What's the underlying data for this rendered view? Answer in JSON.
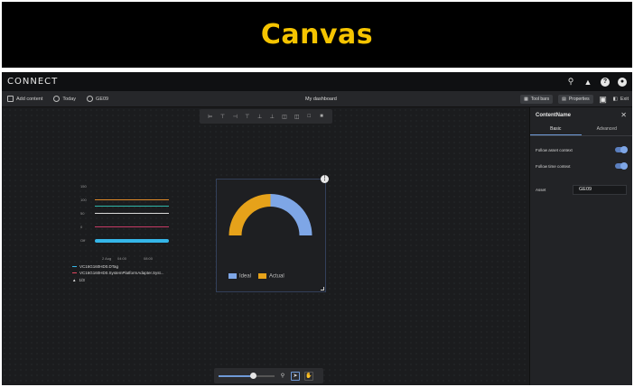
{
  "banner": {
    "title": "Canvas"
  },
  "app": {
    "logo": "CONNECT",
    "toolbar": {
      "add_content": "Add content",
      "today": "Today",
      "asset": "GE09",
      "title": "My dashboard",
      "tool_bars": "Tool bars",
      "properties": "Properties",
      "exit": "Exit"
    }
  },
  "line_widget": {
    "y_ticks": [
      "150",
      "100",
      "50",
      "0",
      "Off"
    ],
    "x_ticks": [
      "2 Aug",
      "04:00",
      "08:00"
    ],
    "legend": [
      {
        "name": "VC16G160HD0.DTag",
        "color": "#35b6e8"
      },
      {
        "name": "VC16G160HD0.SystemPlatformAdapter.Syst...",
        "color": "#e0455e"
      }
    ],
    "pager": "1/3",
    "lines": [
      {
        "color": "#e08a28"
      },
      {
        "color": "#2fb6a8"
      },
      {
        "color": "#d9d9d9"
      },
      {
        "color": "#c73b66"
      },
      {
        "color": "#35b6e8"
      }
    ]
  },
  "gauge_widget": {
    "chart_data": {
      "type": "pie",
      "series": [
        {
          "name": "Ideal",
          "color": "#7ea6e6",
          "value": 0.5
        },
        {
          "name": "Actual",
          "color": "#e6a21a",
          "value": 0.5
        }
      ]
    }
  },
  "panel": {
    "title": "ContentName",
    "tabs": [
      "Basic",
      "Advanced"
    ],
    "follow_asset": "Follow asset context",
    "follow_time": "Follow time context",
    "asset_label": "Asset",
    "asset_value": "GE09"
  },
  "zoom": {
    "level": 0.62
  }
}
